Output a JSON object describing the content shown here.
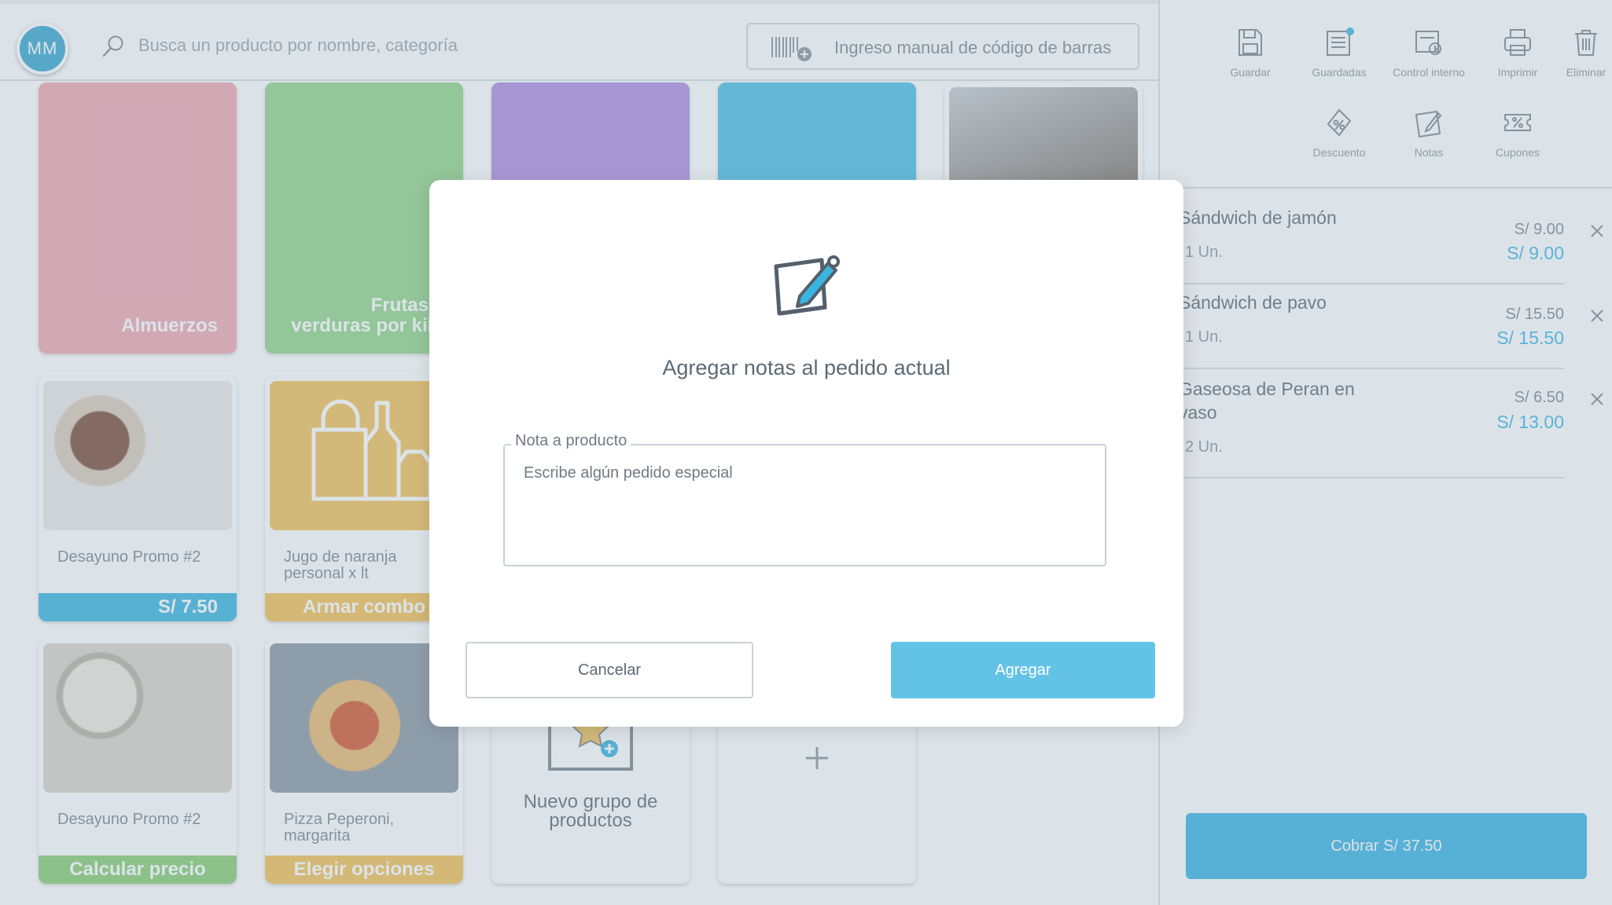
{
  "header": {
    "avatar_initials": "MM",
    "search_placeholder": "Busca un producto por nombre, categoría",
    "barcode_label": "Ingreso manual de código de barras"
  },
  "categories": [
    {
      "label": "Almuerzos",
      "color": "#f0a8b4"
    },
    {
      "label": "Frutas y verduras por kilo",
      "color": "#93d48a"
    },
    {
      "label": "",
      "color": "#b28be0"
    },
    {
      "label": "",
      "color": "#4cbfe3"
    }
  ],
  "products": [
    {
      "name": "Desayuno Promo #2",
      "band": "S/ 7.50",
      "band_color": "#3ab5e0"
    },
    {
      "name": "Jugo de naranja personal x lt",
      "band": "Armar combo",
      "band_color": "#f3bf55"
    },
    {
      "name": "Desayuno Promo #2",
      "band": "Calcular precio",
      "band_color": "#88cc72"
    },
    {
      "name": "Pizza Peperoni, margarita",
      "band": "Elegir opciones",
      "band_color": "#f3bf55"
    }
  ],
  "new_group_label": "Nuevo grupo de productos",
  "toolbar": [
    {
      "label": "Guardar",
      "icon": "save-icon"
    },
    {
      "label": "Guardadas",
      "icon": "saved-list-icon"
    },
    {
      "label": "Control interno",
      "icon": "internal-control-icon"
    },
    {
      "label": "Imprimir",
      "icon": "print-icon"
    },
    {
      "label": "Eliminar",
      "icon": "trash-icon"
    },
    {
      "label": "Descuento",
      "icon": "discount-icon"
    },
    {
      "label": "Notas",
      "icon": "notes-icon"
    },
    {
      "label": "Cupones",
      "icon": "coupon-icon"
    }
  ],
  "order": {
    "items": [
      {
        "name": "Sándwich de jamón",
        "qty": "1 Un.",
        "unit_price": "S/ 9.00",
        "total": "S/ 9.00"
      },
      {
        "name": "Sándwich de pavo",
        "qty": "1 Un.",
        "unit_price": "S/ 15.50",
        "total": "S/ 15.50"
      },
      {
        "name": "Gaseosa de Peran en vaso",
        "qty": "2 Un.",
        "unit_price": "S/ 6.50",
        "total": "S/ 13.00"
      }
    ],
    "charge_label": "Cobrar S/ 37.50"
  },
  "modal": {
    "title": "Agregar notas al pedido actual",
    "field_label": "Nota a producto",
    "field_placeholder": "Escribe algún pedido especial",
    "cancel_label": "Cancelar",
    "add_label": "Agregar"
  },
  "colors": {
    "accent": "#3ab5e0",
    "overlay": "rgba(150,170,185,0.33)"
  }
}
